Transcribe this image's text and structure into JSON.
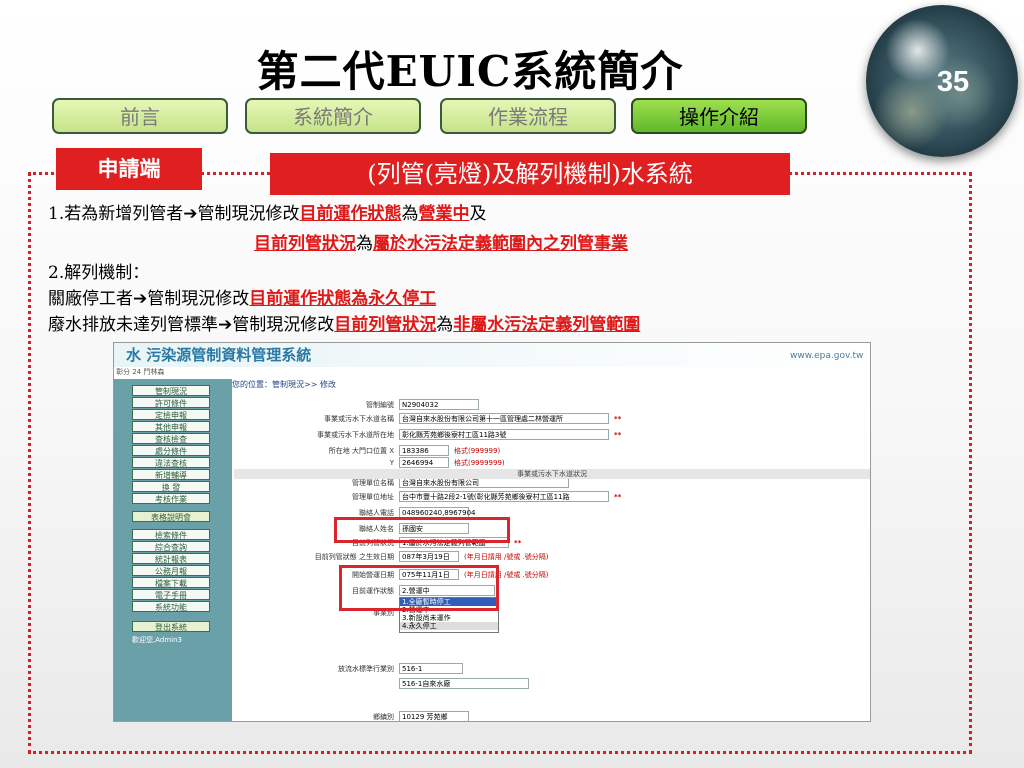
{
  "slide": {
    "number": "35",
    "title": "第二代EUIC系統簡介"
  },
  "tabs": [
    {
      "label": "前言",
      "active": false
    },
    {
      "label": "系統簡介",
      "active": false
    },
    {
      "label": "作業流程",
      "active": false
    },
    {
      "label": "操作介紹",
      "active": true
    }
  ],
  "section": {
    "tag": "申請端",
    "heading": "(列管(亮燈)及解列機制)水系統"
  },
  "body": {
    "l1_num": "1.若為新增列管者",
    "l1_text": "管制現況修改",
    "l1_red1": "目前運作狀態",
    "l1_mid": "為",
    "l1_red2": "營業中",
    "l1_end": "及",
    "l2_red1": "目前列管狀況",
    "l2_mid": "為",
    "l2_red2": "屬於水污法定義範圍內之列管事業",
    "l3": "2.解列機制：",
    "l4_a": "關廠停工者",
    "l4_b": "管制現況修改",
    "l4_red": "目前運作狀態為永久停工",
    "l5_a": "廢水排放未達列管標準",
    "l5_b": "管制現況修改",
    "l5_red1": "目前列管狀況",
    "l5_mid": "為",
    "l5_red2": "非屬水污法定義列管範圍"
  },
  "arrow": "➔",
  "screenshot": {
    "logo": "水 污染源管制資料管理系統",
    "site": "www.epa.gov.tw",
    "user": "彰分 24 鬥林森",
    "location": "您的位置：管制現況>> 修改",
    "menu": [
      "管制現況",
      "許可條件",
      "定檢申報",
      "其他申報",
      "查核檢查",
      "處分條件",
      "違法查核",
      "新增輔導",
      "換 發",
      "考核作業",
      "表格說明會",
      "檢索條件",
      "綜合查詢",
      "統計報表",
      "公務月報",
      "檔案下載",
      "電子手冊",
      "系統功能",
      "登出系統"
    ],
    "menu_footer": "歡迎您,Admin3",
    "fields": [
      {
        "label": "管制編號",
        "value": "N2904032"
      },
      {
        "label": "事業或污水下水道名稱",
        "value": "台灣自來水股份有限公司第十一區管理處二林營運所"
      },
      {
        "label": "事業或污水下水道所在地",
        "value": "彰化縣芳苑鄉後寮村工區11路3號"
      },
      {
        "label": "所在地 大門口位置 X",
        "value": "183386",
        "note": "格式(999999)"
      },
      {
        "label": "Y",
        "value": "2646994",
        "note": "格式(9999999)"
      },
      {
        "label": "管理單位名稱",
        "value": "台灣自來水股份有限公司"
      },
      {
        "label": "管理單位地址",
        "value": "台中市豐十路2段2-1號(彰化縣芳苑鄉後寮村工區11路"
      },
      {
        "label": "聯絡人電話",
        "value": "048960240,8967904"
      },
      {
        "label": "聯絡人姓名",
        "value": "孫國安"
      },
      {
        "label": "目前列管狀況",
        "value": "1.屬於水污法定義列管範圍"
      },
      {
        "label": "目前列管狀態 之生效日期",
        "value": "087年3月19日",
        "note": "(年月日請用 /號或 .號分隔)"
      },
      {
        "label": "開始營運日期",
        "value": "075年11月1日",
        "note": "(年月日請用 /號或 .號分隔)"
      },
      {
        "label": "目前運作狀態",
        "value": "2.營運中"
      },
      {
        "label": "事業別",
        "value": ""
      },
      {
        "label": "放流水標準行業別",
        "value": "516-1"
      },
      {
        "label": "鄉鎮別",
        "value": "10129 芳苑鄉"
      }
    ],
    "section_title": "事業或污水下水道狀況",
    "dropdown": [
      "1.全廠暫時停工",
      "2.營運中",
      "3.新設尚未運作",
      "4.永久停工"
    ],
    "industry_detail": "516-1自來水廠",
    "required_mark": "**"
  }
}
